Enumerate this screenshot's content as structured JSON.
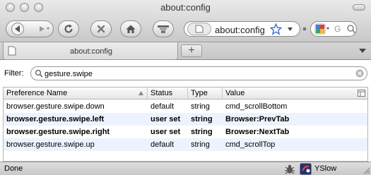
{
  "window": {
    "title": "about:config"
  },
  "toolbar": {
    "url": "about:config",
    "search_placeholder": "G"
  },
  "tabs": [
    {
      "title": "about:config"
    }
  ],
  "newtab_label": "+",
  "filter": {
    "label": "Filter:",
    "value": "gesture.swipe"
  },
  "table": {
    "columns": [
      "Preference Name",
      "Status",
      "Type",
      "Value"
    ],
    "rows": [
      {
        "name": "browser.gesture.swipe.down",
        "status": "default",
        "type": "string",
        "value": "cmd_scrollBottom",
        "bold": false
      },
      {
        "name": "browser.gesture.swipe.left",
        "status": "user set",
        "type": "string",
        "value": "Browser:PrevTab",
        "bold": true
      },
      {
        "name": "browser.gesture.swipe.right",
        "status": "user set",
        "type": "string",
        "value": "Browser:NextTab",
        "bold": true
      },
      {
        "name": "browser.gesture.swipe.up",
        "status": "default",
        "type": "string",
        "value": "cmd_scrollTop",
        "bold": false
      }
    ]
  },
  "statusbar": {
    "text": "Done",
    "yslow": "YSlow"
  },
  "icons": {
    "back": "back-arrow-icon",
    "forward": "forward-arrow-icon",
    "reload": "reload-icon",
    "stop": "stop-icon",
    "home": "home-icon",
    "bookmarks": "bookmarks-icon",
    "star": "bookmark-star-icon",
    "google": "google-icon",
    "search": "magnifier-icon",
    "clear": "clear-filter-icon",
    "sort": "sort-arrow-icon",
    "column-picker": "column-picker-icon",
    "firebug": "firebug-icon",
    "yslow": "yslow-icon"
  },
  "colors": {
    "row_alt": "#edf3fe",
    "chrome": "#d6d6d6",
    "star": "#3a6fd4"
  }
}
